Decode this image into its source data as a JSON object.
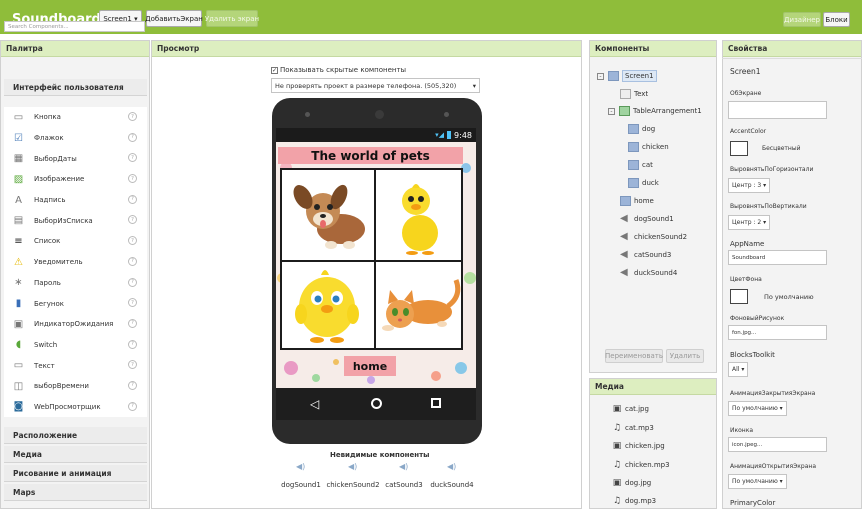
{
  "app": {
    "title": "Soundboard"
  },
  "toolbar": {
    "screen_select": "Screen1 ▾",
    "add_screen": "ДобавитьЭкран",
    "remove_screen": "Удалить экран",
    "designer": "Дизайнер",
    "blocks": "Блоки"
  },
  "palette": {
    "header": "Палитра",
    "search_placeholder": "Search Components...",
    "section_ui": "Интерфейс пользователя",
    "items": [
      {
        "label": "Кнопка",
        "icon": "button-icon"
      },
      {
        "label": "Флажок",
        "icon": "checkbox-icon"
      },
      {
        "label": "ВыборДаты",
        "icon": "datepicker-icon"
      },
      {
        "label": "Изображение",
        "icon": "image-icon"
      },
      {
        "label": "Надпись",
        "icon": "label-icon"
      },
      {
        "label": "ВыборИзСписка",
        "icon": "listpicker-icon"
      },
      {
        "label": "Список",
        "icon": "listview-icon"
      },
      {
        "label": "Уведомитель",
        "icon": "notifier-icon"
      },
      {
        "label": "Пароль",
        "icon": "password-icon"
      },
      {
        "label": "Бегунок",
        "icon": "slider-icon"
      },
      {
        "label": "ИндикаторОжидания",
        "icon": "spinner-icon"
      },
      {
        "label": "Switch",
        "icon": "switch-icon"
      },
      {
        "label": "Текст",
        "icon": "textbox-icon"
      },
      {
        "label": "выборВремени",
        "icon": "timepicker-icon"
      },
      {
        "label": "WebПросмотрщик",
        "icon": "webviewer-icon"
      }
    ],
    "help_glyph": "?",
    "sections": [
      "Расположение",
      "Медиа",
      "Рисование и анимация",
      "Maps"
    ]
  },
  "viewer": {
    "header": "Просмотр",
    "show_hidden": "Показывать скрытые компоненты",
    "size_select": "Не проверять проект в размере телефона. (505,320)",
    "time": "9:48",
    "app_title": "The world of pets",
    "home_button": "home",
    "nonvisible_title": "Невидимые компоненты",
    "nonvisible": [
      "dogSound1",
      "chickenSound2",
      "catSound3",
      "duckSound4"
    ]
  },
  "components": {
    "header": "Компоненты",
    "tree": [
      {
        "label": "Screen1",
        "level": 0,
        "toggle": "⊟"
      },
      {
        "label": "Text",
        "level": 1
      },
      {
        "label": "TableArrangement1",
        "level": 1,
        "toggle": "⊟"
      },
      {
        "label": "dog",
        "level": 2
      },
      {
        "label": "chicken",
        "level": 2
      },
      {
        "label": "cat",
        "level": 2
      },
      {
        "label": "duck",
        "level": 2
      },
      {
        "label": "home",
        "level": 1
      },
      {
        "label": "dogSound1",
        "level": 1
      },
      {
        "label": "chickenSound2",
        "level": 1
      },
      {
        "label": "catSound3",
        "level": 1
      },
      {
        "label": "duckSound4",
        "level": 1
      }
    ],
    "rename": "Переименовать",
    "delete": "Удалить"
  },
  "media": {
    "header": "Медиа",
    "files": [
      "cat.jpg",
      "cat.mp3",
      "chicken.jpg",
      "chicken.mp3",
      "dog.jpg",
      "dog.mp3"
    ]
  },
  "properties": {
    "header": "Свойства",
    "component": "Screen1",
    "about_label": "ОбЭкране",
    "accent_label": "AccentColor",
    "accent_value": "Бесцветный",
    "halign_label": "ВыровнятьПоГоризонтали",
    "halign_value": "Центр : 3 ▾",
    "valign_label": "ВыровнятьПоВертикали",
    "valign_value": "Центр : 2 ▾",
    "appname_label": "AppName",
    "appname_value": "Soundboard",
    "bg_label": "ЦветФона",
    "bg_value": "По умолчанию",
    "bgimage_label": "ФоновыйРисунок",
    "bgimage_value": "fon.jpg...",
    "blocks_label": "BlocksToolkit",
    "blocks_value": "All ▾",
    "close_anim_label": "АнимацияЗакрытияЭкрана",
    "close_anim_value": "По умолчанию ▾",
    "icon_label": "Иконка",
    "icon_value": "icon.jpeg...",
    "open_anim_label": "АнимацияОткрытияЭкрана",
    "open_anim_value": "По умолчанию ▾",
    "primary_label": "PrimaryColor"
  },
  "colors": {
    "topbar": "#8fbd3a",
    "panel_header": "#ddeec0",
    "title_pink": "#f2a2a8"
  }
}
